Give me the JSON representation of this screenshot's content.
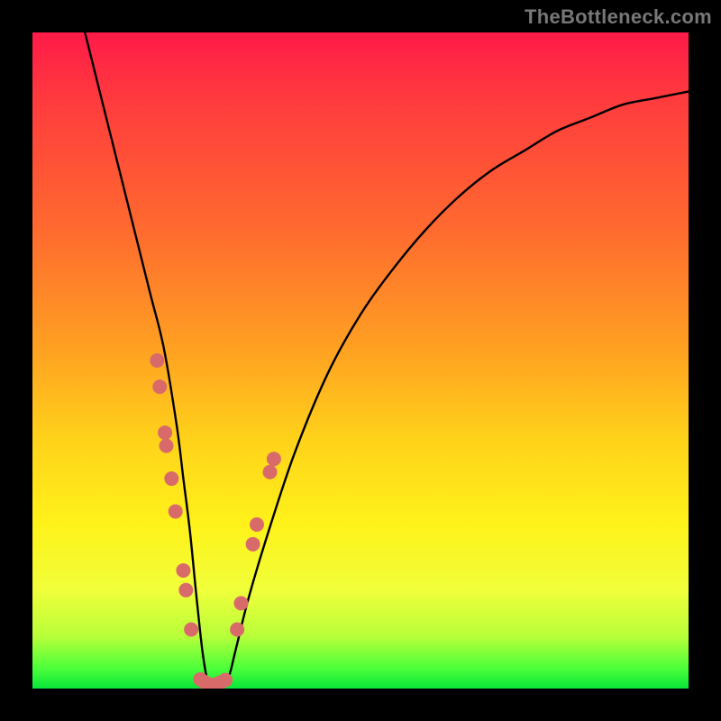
{
  "watermark": "TheBottleneck.com",
  "chart_data": {
    "type": "line",
    "title": "",
    "xlabel": "",
    "ylabel": "",
    "xlim": [
      0,
      100
    ],
    "ylim": [
      0,
      100
    ],
    "background_gradient": {
      "orientation": "vertical",
      "stops": [
        {
          "pos": 0.0,
          "color": "#ff1a48"
        },
        {
          "pos": 0.3,
          "color": "#ff6a2f"
        },
        {
          "pos": 0.62,
          "color": "#ffd21a"
        },
        {
          "pos": 0.85,
          "color": "#f0ff3a"
        },
        {
          "pos": 1.0,
          "color": "#09e63a"
        }
      ]
    },
    "series": [
      {
        "name": "bottleneck-curve",
        "color": "#000000",
        "x": [
          8,
          10,
          12,
          14,
          16,
          18,
          20,
          22,
          23,
          24,
          25,
          26,
          27,
          28,
          29,
          30,
          31,
          33,
          36,
          40,
          45,
          50,
          55,
          60,
          65,
          70,
          75,
          80,
          85,
          90,
          95,
          100
        ],
        "y": [
          100,
          92,
          84,
          76,
          68,
          60,
          52,
          40,
          32,
          24,
          14,
          5,
          0,
          0,
          0,
          2,
          6,
          14,
          24,
          36,
          48,
          57,
          64,
          70,
          75,
          79,
          82,
          85,
          87,
          89,
          90,
          91
        ]
      }
    ],
    "markers": {
      "name": "highlight-points",
      "color": "#d96a6a",
      "radius_px": 8,
      "points_xy": [
        [
          19,
          50
        ],
        [
          19.4,
          46
        ],
        [
          20.2,
          39
        ],
        [
          20.4,
          37
        ],
        [
          21.2,
          32
        ],
        [
          21.8,
          27
        ],
        [
          23.0,
          18
        ],
        [
          23.4,
          15
        ],
        [
          24.2,
          9
        ],
        [
          25.6,
          1.4
        ],
        [
          26.2,
          1.0
        ],
        [
          27.0,
          0.6
        ],
        [
          27.8,
          0.6
        ],
        [
          28.6,
          0.9
        ],
        [
          29.4,
          1.3
        ],
        [
          31.2,
          9
        ],
        [
          31.8,
          13
        ],
        [
          33.6,
          22
        ],
        [
          34.2,
          25
        ],
        [
          36.2,
          33
        ],
        [
          36.8,
          35
        ]
      ]
    }
  }
}
